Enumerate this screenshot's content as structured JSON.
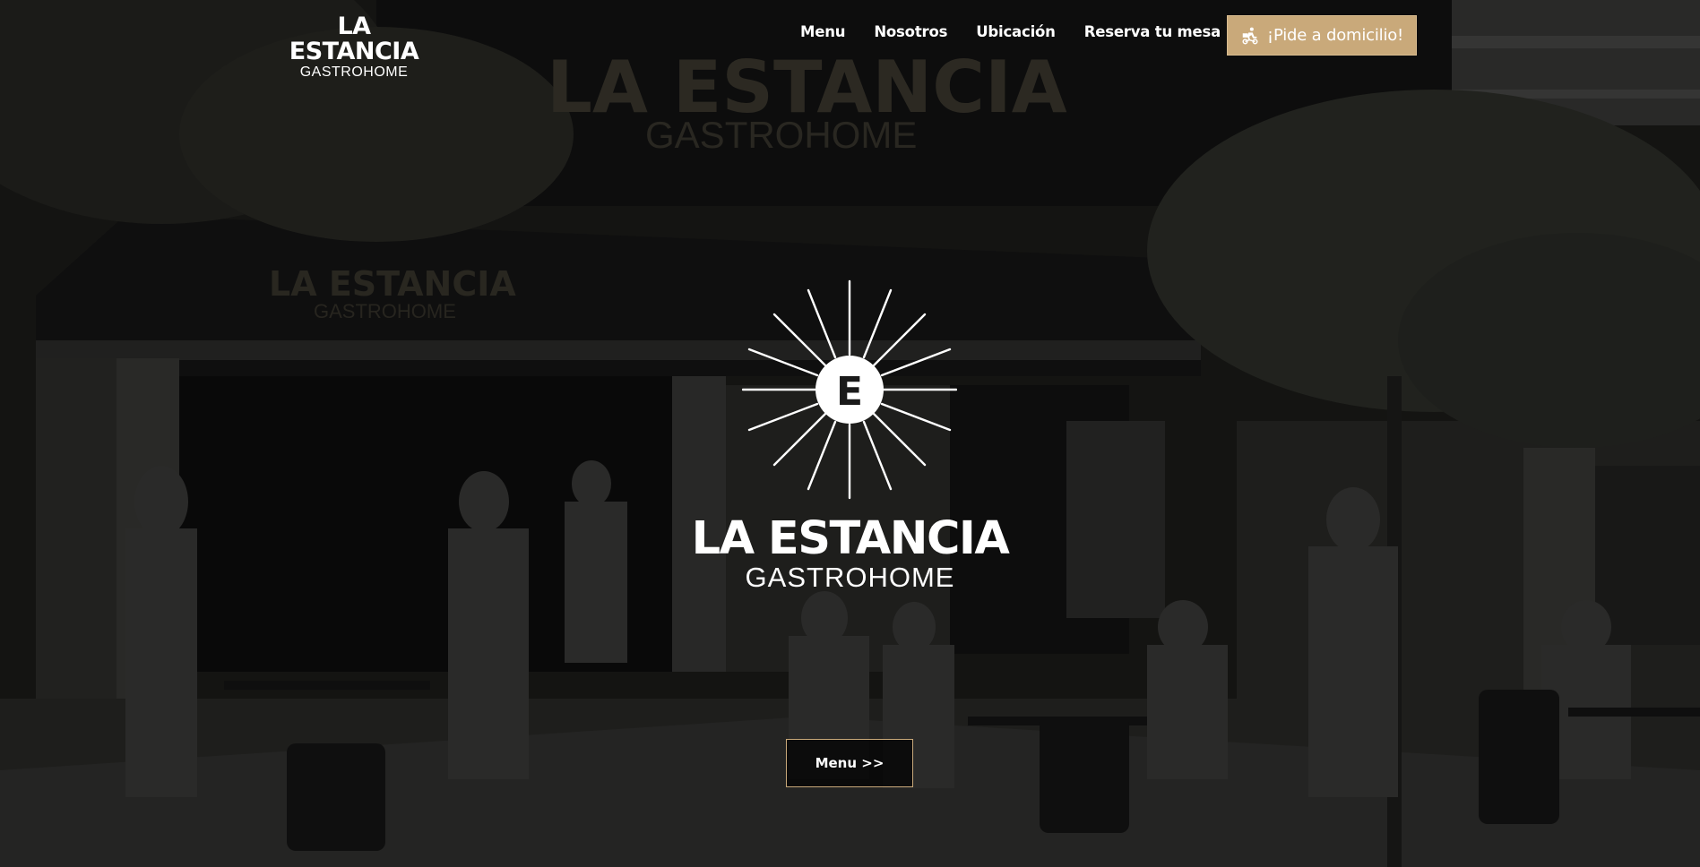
{
  "header": {
    "logo_title": "LA ESTANCIA",
    "logo_subtitle": "GASTROHOME",
    "nav": [
      {
        "label": "Menu"
      },
      {
        "label": "Nosotros"
      },
      {
        "label": "Ubicación"
      },
      {
        "label": "Reserva tu mesa"
      }
    ],
    "cta_label": "¡Pide a domicilio!",
    "cta_icon": "delivery-rider-icon"
  },
  "hero": {
    "emblem_letter": "E",
    "emblem_icon": "sunburst-emblem-icon",
    "title": "LA ESTANCIA",
    "subtitle": "GASTROHOME",
    "menu_button_label": "Menu >>"
  },
  "colors": {
    "accent": "#c9a97a",
    "text": "#ffffff",
    "overlay": "#000000"
  }
}
